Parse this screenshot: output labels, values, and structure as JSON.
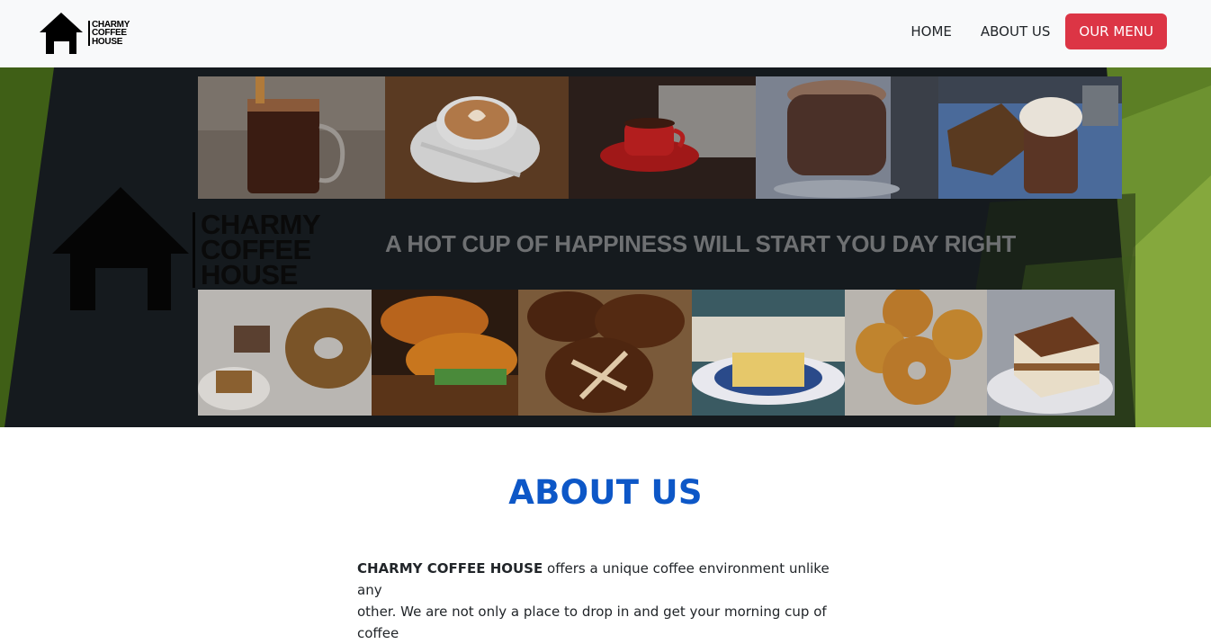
{
  "navbar": {
    "brand_lines": [
      "CHARMY",
      "COFFEE",
      "HOUSE"
    ],
    "links": [
      {
        "label": "HOME"
      },
      {
        "label": "ABOUT US"
      }
    ],
    "menu_button": "OUR MENU"
  },
  "hero": {
    "brand_lines": [
      "CHARMY",
      "COFFEE",
      "HOUSE"
    ],
    "tagline": "A HOT CUP OF HAPPINESS WILL START YOU DAY RIGHT",
    "top_photos": [
      "iced-coffee-glass",
      "latte-art-cup",
      "red-espresso-cup",
      "hot-chocolate-glass",
      "cream-topped-mocha"
    ],
    "bottom_photos": [
      "coffee-cake",
      "croissants",
      "pretzel-rolls",
      "custard-slice",
      "bagels",
      "tiramisu"
    ]
  },
  "about": {
    "title": "ABOUT US",
    "brand_bold": "CHARMY COFFEE HOUSE",
    "line1_rest": " offers a unique coffee environment unlike any",
    "line2": "other. We are not only a place to drop in and get your morning cup of coffee"
  },
  "colors": {
    "navbar_bg": "#f8f9fa",
    "menu_button_bg": "#dc3545",
    "about_title": "#0d57c7",
    "hero_green": "#4a6a1a",
    "hero_dark": "#151a1e"
  }
}
